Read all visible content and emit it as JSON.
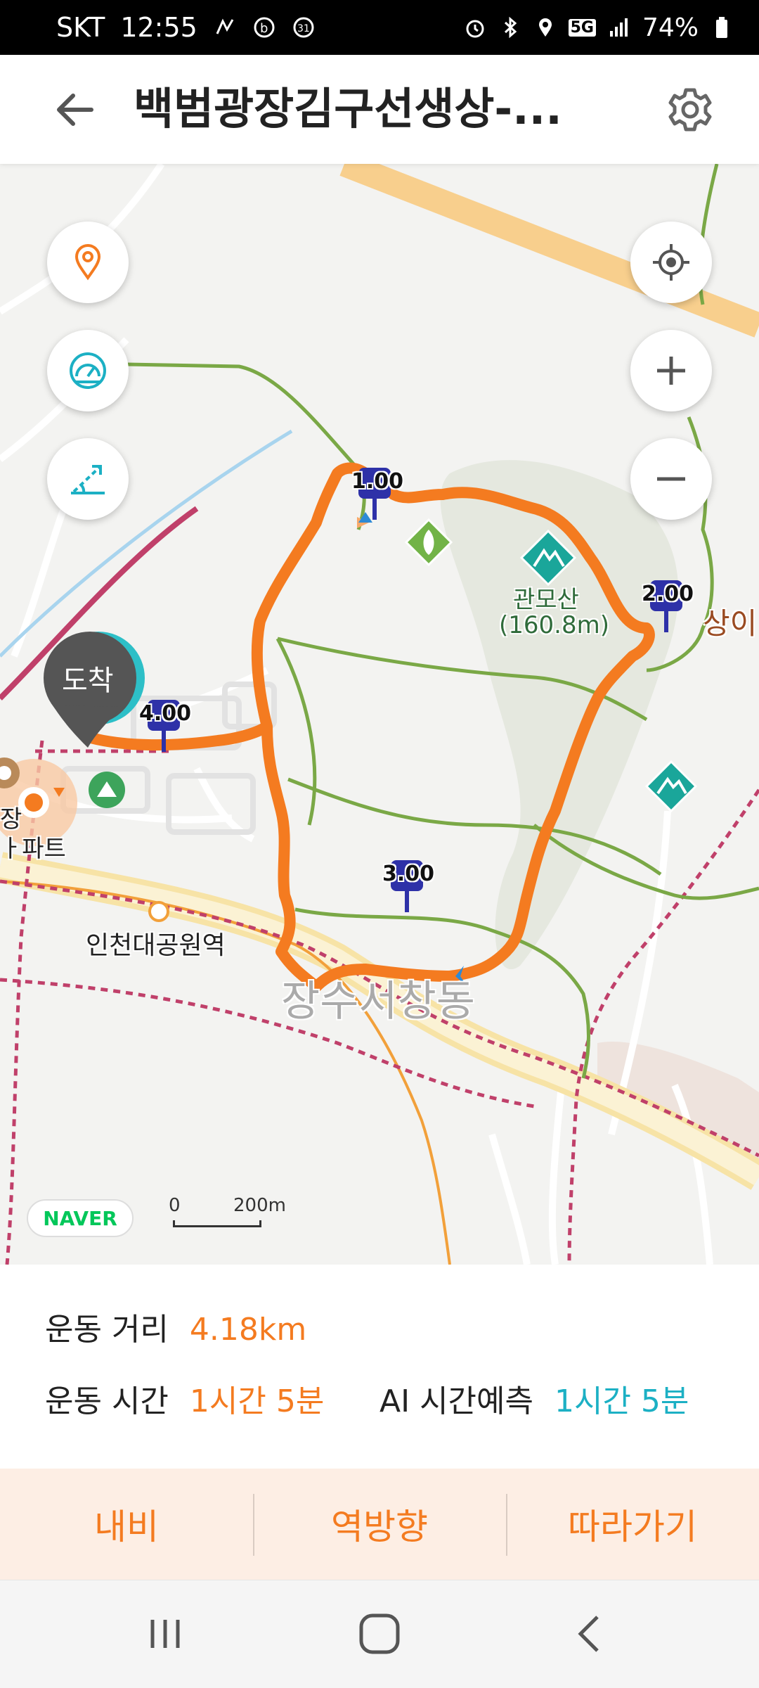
{
  "status_bar": {
    "carrier": "SKT",
    "time": "12:55",
    "network": "5G",
    "battery": "74%",
    "icons": [
      "activity-icon",
      "b-app-icon",
      "calendar-31-icon",
      "alarm-icon",
      "bluetooth-icon",
      "location-icon",
      "signal-icon",
      "battery-icon"
    ]
  },
  "header": {
    "title": "백범광장김구선생상-...",
    "back_icon": "arrow-left-icon",
    "settings_icon": "gear-icon"
  },
  "map": {
    "controls_left": [
      "location-pin-icon",
      "speedometer-icon",
      "slope-icon"
    ],
    "controls_right": [
      "my-location-icon",
      "zoom-in-icon",
      "zoom-out-icon"
    ],
    "km_markers": [
      "1.00",
      "2.00",
      "3.00",
      "4.00"
    ],
    "arrival_label": "도착",
    "peak_name": "관모산",
    "peak_elevation": "(160.8m)",
    "label_sangi": "상이",
    "station": "인천대공원역",
    "district": "장수서창동",
    "partial_label_1": "장",
    "partial_label_2": "ㅏ파트",
    "naver": "NAVER",
    "scale_zero": "0",
    "scale_distance": "200m",
    "colors": {
      "route": "#f47b20",
      "trail": "#7aa846",
      "road": "#f8cf8d",
      "rail": "#c0406a",
      "km_marker": "#2e31a8",
      "peak": "#1aa69a"
    }
  },
  "stats": {
    "distance_label": "운동 거리",
    "distance_value": "4.18km",
    "time_label": "운동 시간",
    "time_value": "1시간 5분",
    "ai_label": "AI 시간예측",
    "ai_value": "1시간 5분"
  },
  "actions": {
    "nav": "내비",
    "reverse": "역방향",
    "follow": "따라가기"
  },
  "system_nav": [
    "recent-apps-icon",
    "home-icon",
    "back-icon"
  ]
}
